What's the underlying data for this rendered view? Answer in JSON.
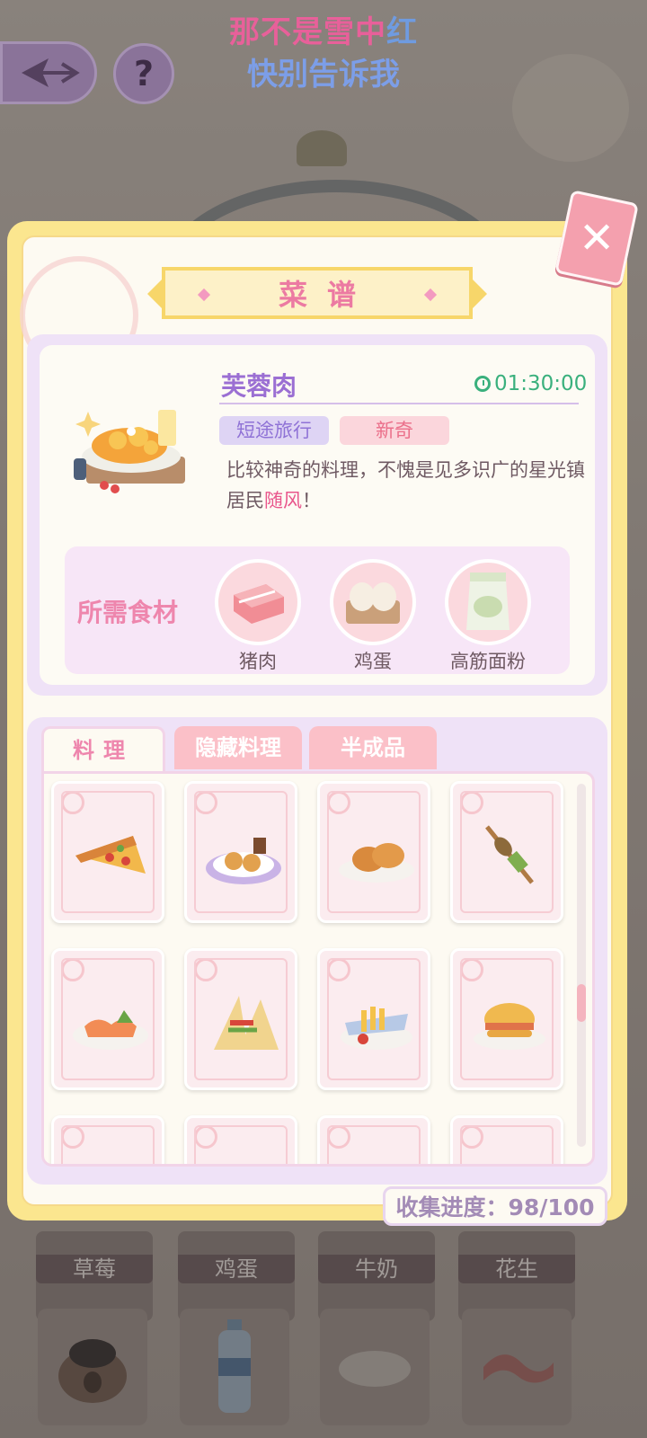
{
  "banner": {
    "line1_pink": "那不是雪中",
    "line1_blue": "红",
    "line2": "快别告诉我"
  },
  "top_buttons": {
    "help_label": "?"
  },
  "background_shelf": {
    "labels": [
      "草莓",
      "鸡蛋",
      "牛奶",
      "花生"
    ]
  },
  "modal": {
    "title": "菜谱",
    "close_label": "✕",
    "recipe": {
      "name": "芙蓉肉",
      "time": "01:30:00",
      "tags": [
        "短途旅行",
        "新奇"
      ],
      "desc_prefix": "比较神奇的料理，不愧是见多识广的星光镇居民",
      "desc_highlight": "随风",
      "desc_suffix": "！"
    },
    "ingredients": {
      "title": "所需食材",
      "items": [
        {
          "label": "猪肉",
          "icon": "pork-icon"
        },
        {
          "label": "鸡蛋",
          "icon": "eggs-icon"
        },
        {
          "label": "高筋面粉",
          "icon": "flour-icon"
        }
      ]
    },
    "tabs": [
      "料理",
      "隐藏料理",
      "半成品"
    ],
    "active_tab": 0,
    "dishes": [
      {
        "icon": "pizza-slice-icon"
      },
      {
        "icon": "fried-platter-icon"
      },
      {
        "icon": "buns-icon"
      },
      {
        "icon": "fish-skewer-icon"
      },
      {
        "icon": "sashimi-icon"
      },
      {
        "icon": "sandwich-icon"
      },
      {
        "icon": "fries-plate-icon"
      },
      {
        "icon": "burger-icon"
      }
    ],
    "progress_label": "收集进度：98/100",
    "progress": {
      "collected": 98,
      "total": 100
    }
  },
  "colors": {
    "accent_pink": "#ee86ad",
    "accent_purple": "#9b6fd3",
    "timer_green": "#3ab07d",
    "frame_yellow": "#fbe68f"
  }
}
